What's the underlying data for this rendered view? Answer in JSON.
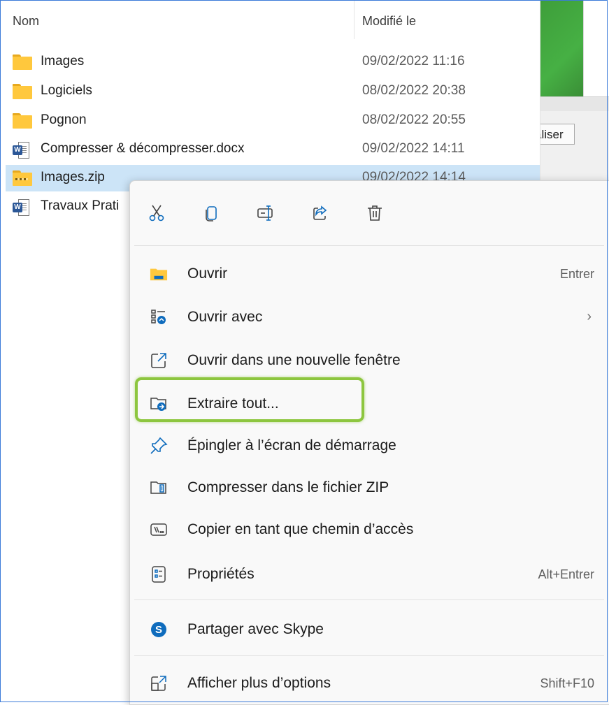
{
  "background_window": {
    "partial_button_label": "aliser"
  },
  "file_list": {
    "headers": {
      "name": "Nom",
      "modified": "Modifié le"
    },
    "rows": [
      {
        "name": "Images",
        "date": "09/02/2022 11:16",
        "type": "folder",
        "selected": false
      },
      {
        "name": "Logiciels",
        "date": "08/02/2022 20:38",
        "type": "folder",
        "selected": false
      },
      {
        "name": "Pognon",
        "date": "08/02/2022 20:55",
        "type": "folder",
        "selected": false
      },
      {
        "name": "Compresser & décompresser.docx",
        "date": "09/02/2022 14:11",
        "type": "word-document",
        "selected": false
      },
      {
        "name": "Images.zip",
        "date": "09/02/2022 14:14",
        "type": "zip-folder",
        "selected": true
      },
      {
        "name": "Travaux Prati",
        "date": "",
        "type": "word-document",
        "selected": false
      }
    ]
  },
  "context_menu": {
    "toolbar": [
      {
        "icon": "cut-icon"
      },
      {
        "icon": "copy-icon"
      },
      {
        "icon": "rename-icon"
      },
      {
        "icon": "share-icon"
      },
      {
        "icon": "delete-icon"
      }
    ],
    "items": [
      {
        "label": "Ouvrir",
        "shortcut": "Entrer",
        "icon": "folder-open-icon"
      },
      {
        "label": "Ouvrir avec",
        "shortcut": "",
        "icon": "open-with-icon",
        "submenu": true
      },
      {
        "label": "Ouvrir dans une nouvelle fenêtre",
        "shortcut": "",
        "icon": "new-window-icon"
      },
      {
        "label": "Extraire tout...",
        "shortcut": "",
        "icon": "extract-all-icon",
        "highlighted": true
      },
      {
        "label": "Épingler à l’écran de démarrage",
        "shortcut": "",
        "icon": "pin-icon"
      },
      {
        "label": "Compresser dans le fichier ZIP",
        "shortcut": "",
        "icon": "zip-icon"
      },
      {
        "label": "Copier en tant que chemin d’accès",
        "shortcut": "",
        "icon": "copy-path-icon"
      },
      {
        "label": "Propriétés",
        "shortcut": "Alt+Entrer",
        "icon": "properties-icon"
      },
      {
        "label": "Partager avec Skype",
        "shortcut": "",
        "icon": "skype-icon"
      },
      {
        "label": "Afficher plus d’options",
        "shortcut": "Shift+F10",
        "icon": "more-options-icon"
      }
    ]
  },
  "colors": {
    "selection": "#cce4f7",
    "highlight_border": "#8dc63f",
    "accent_blue": "#0067c0",
    "folder_yellow": "#ffc83d"
  }
}
